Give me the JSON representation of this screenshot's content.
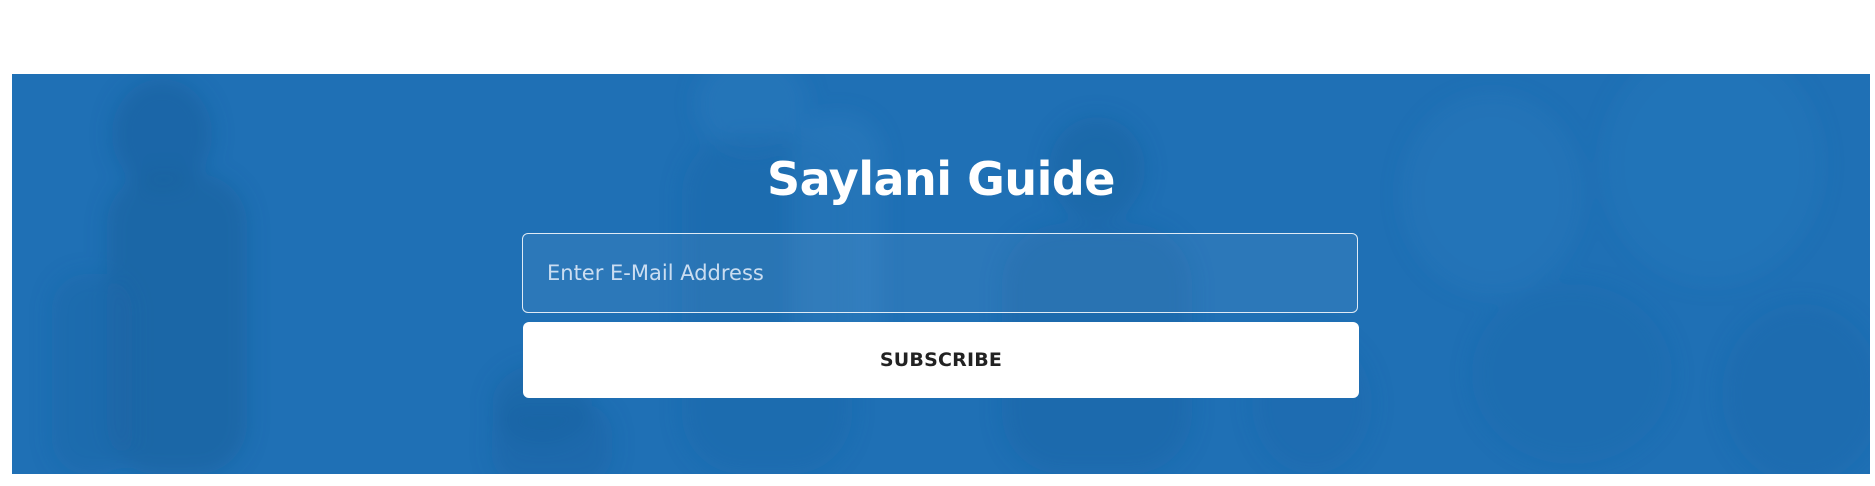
{
  "newsletter": {
    "title": "Saylani Guide",
    "email_placeholder": "Enter E-Mail Address",
    "email_value": "",
    "subscribe_label": "SUBSCRIBE"
  },
  "colors": {
    "banner_blue": "#1f6fb4",
    "button_bg": "#ffffff",
    "button_text": "#222222",
    "title_text": "#ffffff"
  }
}
